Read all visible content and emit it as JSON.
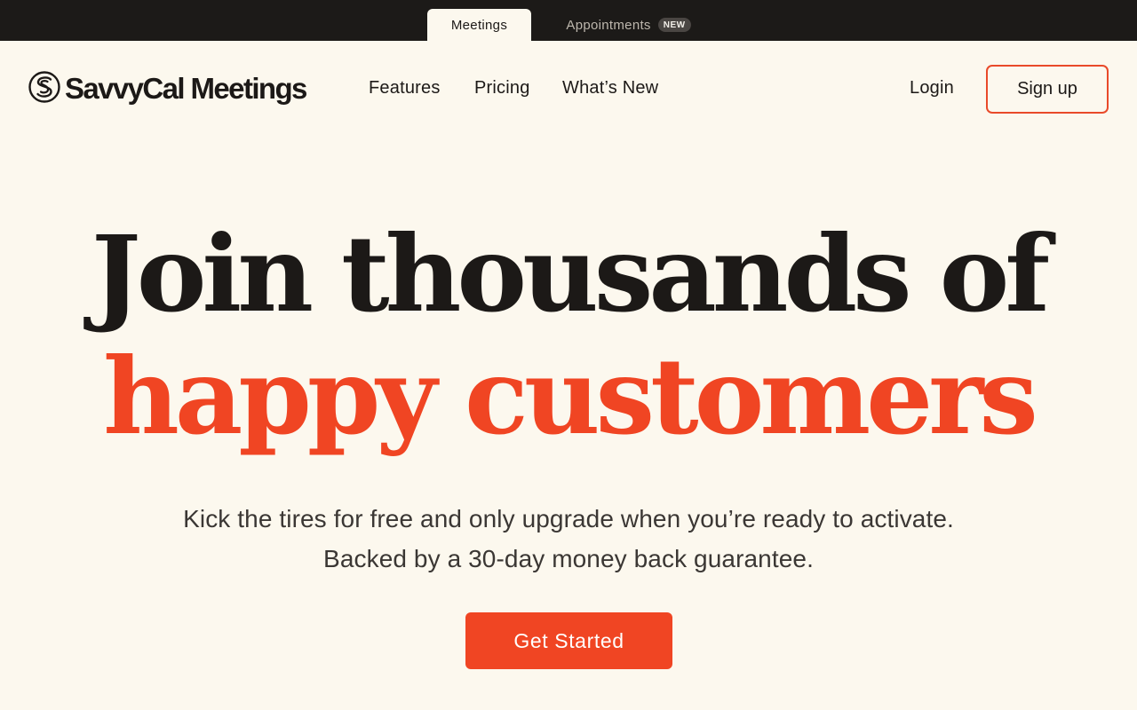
{
  "product_tabs": [
    {
      "label": "Meetings",
      "active": true
    },
    {
      "label": "Appointments",
      "badge": "NEW",
      "active": false
    }
  ],
  "brand": {
    "name": "SavvyCal Meetings",
    "logo_icon": "savvycal-s-icon"
  },
  "nav": {
    "links": [
      "Features",
      "Pricing",
      "What’s New"
    ],
    "login": "Login",
    "signup": "Sign up"
  },
  "hero": {
    "headline_line1": "Join thousands of",
    "headline_line2": "happy customers",
    "subtext_line1": "Kick the tires for free and only upgrade when you’re ready to activate.",
    "subtext_line2": "Backed by a 30-day money back guarantee.",
    "cta": "Get Started"
  },
  "colors": {
    "background": "#fcf8ee",
    "topbar": "#1c1a18",
    "accent": "#f04523",
    "text": "#1c1917"
  }
}
